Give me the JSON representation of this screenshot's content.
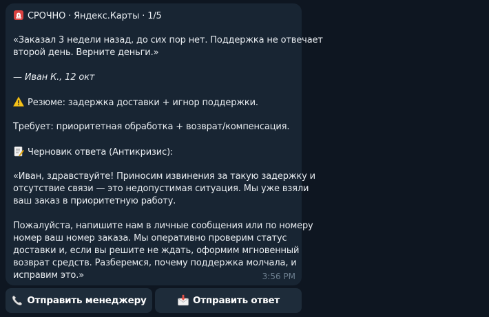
{
  "message": {
    "header": "СРОЧНО · Яндекс.Карты · 1/5",
    "quote_lines": [
      "«Заказал 3 недели назад, до сих пор нет. Поддержка не отвечает",
      "второй день. Верните деньги.»"
    ],
    "author": "— Иван К., 12 окт",
    "summary": "Резюме: задержка доставки + игнор поддержки.",
    "requires": "Требует: приоритетная обработка + возврат/компенсация.",
    "draft_heading": "Черновик ответа (Антикризис):",
    "draft_p1_lines": [
      "«Иван, здравствуйте! Приносим извинения за такую задержку и",
      "отсутствие связи — это недопустимая ситуация. Мы уже взяли",
      "ваш заказ в приоритетную работу."
    ],
    "draft_p2_lines": [
      "Пожалуйста, напишите нам в личные сообщения или по номеру",
      "номер ваш номер заказа. Мы оперативно проверим статус",
      "доставки и, если вы решите не ждать, оформим мгновенный",
      "возврат средств. Разберемся, почему поддержка молчала, и",
      "исправим это.»"
    ],
    "time": "3:56 PM"
  },
  "buttons": {
    "send_manager": "Отправить менеджеру",
    "send_reply": "Отправить ответ"
  },
  "icons": {
    "header": "rotating-light-icon",
    "summary": "warning-icon",
    "draft": "memo-icon",
    "send_manager": "phone-receiver-icon",
    "send_reply": "envelope-with-arrow-icon"
  },
  "colors": {
    "background": "#0e1621",
    "bubble": "#182533",
    "button": "#1e2c3a",
    "text": "#e9edf1",
    "time": "#6d7f8f"
  }
}
